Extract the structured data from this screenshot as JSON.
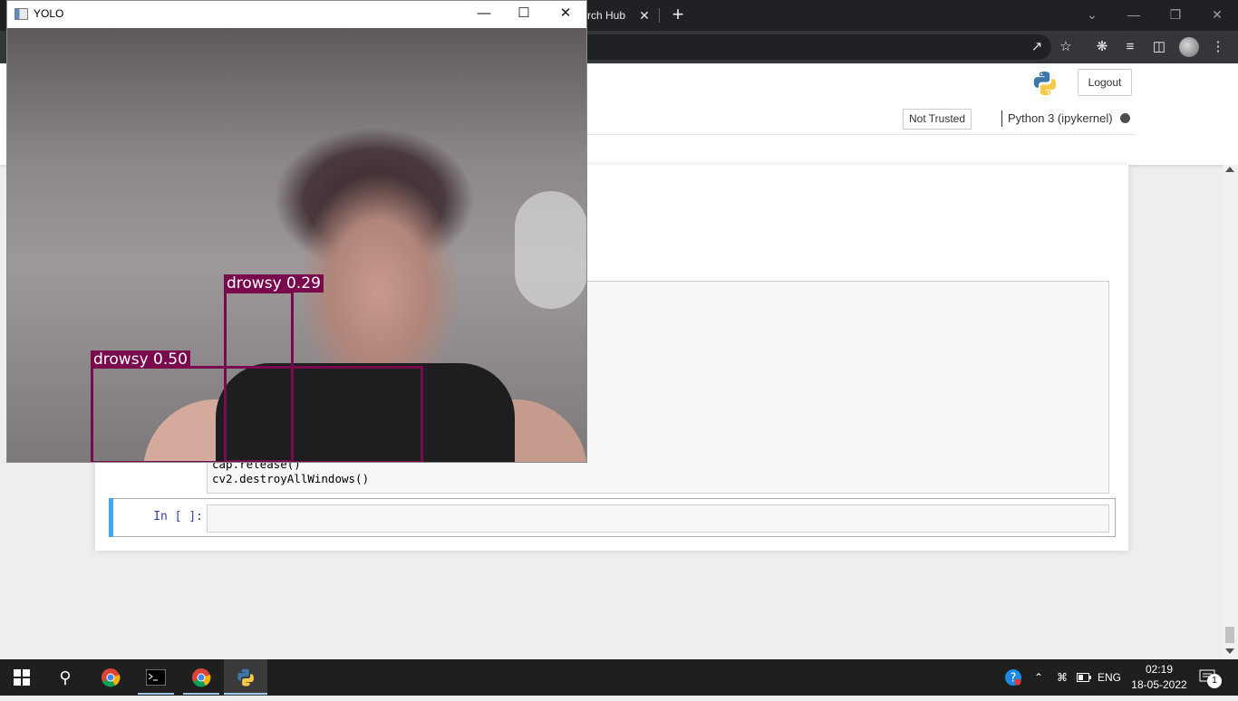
{
  "browser": {
    "tab_fragment": "rch Hub",
    "tab_close": "✕",
    "new_tab": "+"
  },
  "jupyter": {
    "logout_label": "Logout",
    "trust_label": "Not Trusted",
    "kernel_name": "Python 3 (ipykernel)"
  },
  "notebook": {
    "code_lines": [
      "cap.release()",
      "cv2.destroyAllWindows()"
    ],
    "prompt_label": "In [ ]:"
  },
  "yolo_window": {
    "title": "YOLO",
    "detections": [
      {
        "label": "drowsy 0.29"
      },
      {
        "label": "drowsy 0.50"
      }
    ],
    "box_color": "#7a0a4e"
  },
  "taskbar": {
    "language": "ENG",
    "time": "02:19",
    "date": "18-05-2022",
    "notification_count": "1",
    "icons": [
      "windows-start-icon",
      "search-icon",
      "chrome-icon",
      "terminal-icon",
      "chrome-icon",
      "python-icon"
    ]
  }
}
